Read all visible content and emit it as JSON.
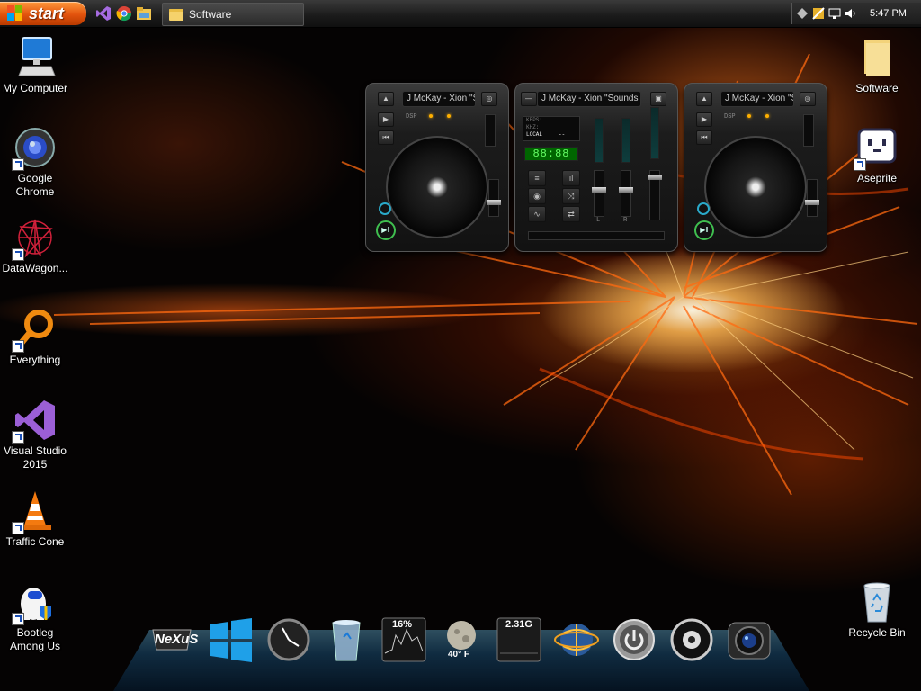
{
  "taskbar": {
    "start_label": "start",
    "quick_launch": [
      "visual-studio-icon",
      "chrome-icon",
      "explorer-icon"
    ],
    "task_button_label": "Software",
    "tray_icons": [
      "diamond-icon",
      "security-icon",
      "network-icon",
      "volume-icon"
    ],
    "clock": "5:47 PM"
  },
  "desktop_left": [
    {
      "label": "My Computer",
      "icon": "computer-icon"
    },
    {
      "label": "Google Chrome",
      "icon": "chrome-icon"
    },
    {
      "label": "DataWagon...",
      "icon": "datawagon-icon"
    },
    {
      "label": "Everything",
      "icon": "search-icon"
    },
    {
      "label": "Visual Studio 2015",
      "icon": "visual-studio-icon"
    },
    {
      "label": "Traffic Cone",
      "icon": "traffic-cone-icon"
    },
    {
      "label": "Bootleg Among Us",
      "icon": "among-us-icon"
    }
  ],
  "desktop_right": [
    {
      "label": "Software",
      "icon": "folder-icon"
    },
    {
      "label": "Aseprite",
      "icon": "aseprite-icon"
    },
    {
      "label": "Recycle Bin",
      "icon": "recycle-bin-icon"
    }
  ],
  "dj_widget": {
    "deck_a_title": "J McKay - Xion \"S",
    "deck_b_title": "J McKay - Xion \"S",
    "mixer_title": "J McKay - Xion \"Sounds",
    "lcd_kbps": "KBPS:",
    "lcd_khz": "KHZ:",
    "lcd_local": "LOCAL",
    "lcd_dashes": "--",
    "dsp_label": "DSP",
    "fader_left": "L",
    "fader_right": "R"
  },
  "dock": {
    "items": [
      {
        "name": "nexus-logo",
        "label": "NeXuS"
      },
      {
        "name": "windows-icon",
        "label": ""
      },
      {
        "name": "clock-widget",
        "label": ""
      },
      {
        "name": "recycle-bin-icon",
        "label": ""
      },
      {
        "name": "cpu-meter",
        "label": "16%"
      },
      {
        "name": "weather-widget",
        "label": "40° F"
      },
      {
        "name": "memory-meter",
        "label": "2.31G"
      },
      {
        "name": "network-globe-icon",
        "label": ""
      },
      {
        "name": "power-icon",
        "label": ""
      },
      {
        "name": "speaker-icon",
        "label": ""
      },
      {
        "name": "camera-icon",
        "label": ""
      }
    ]
  }
}
